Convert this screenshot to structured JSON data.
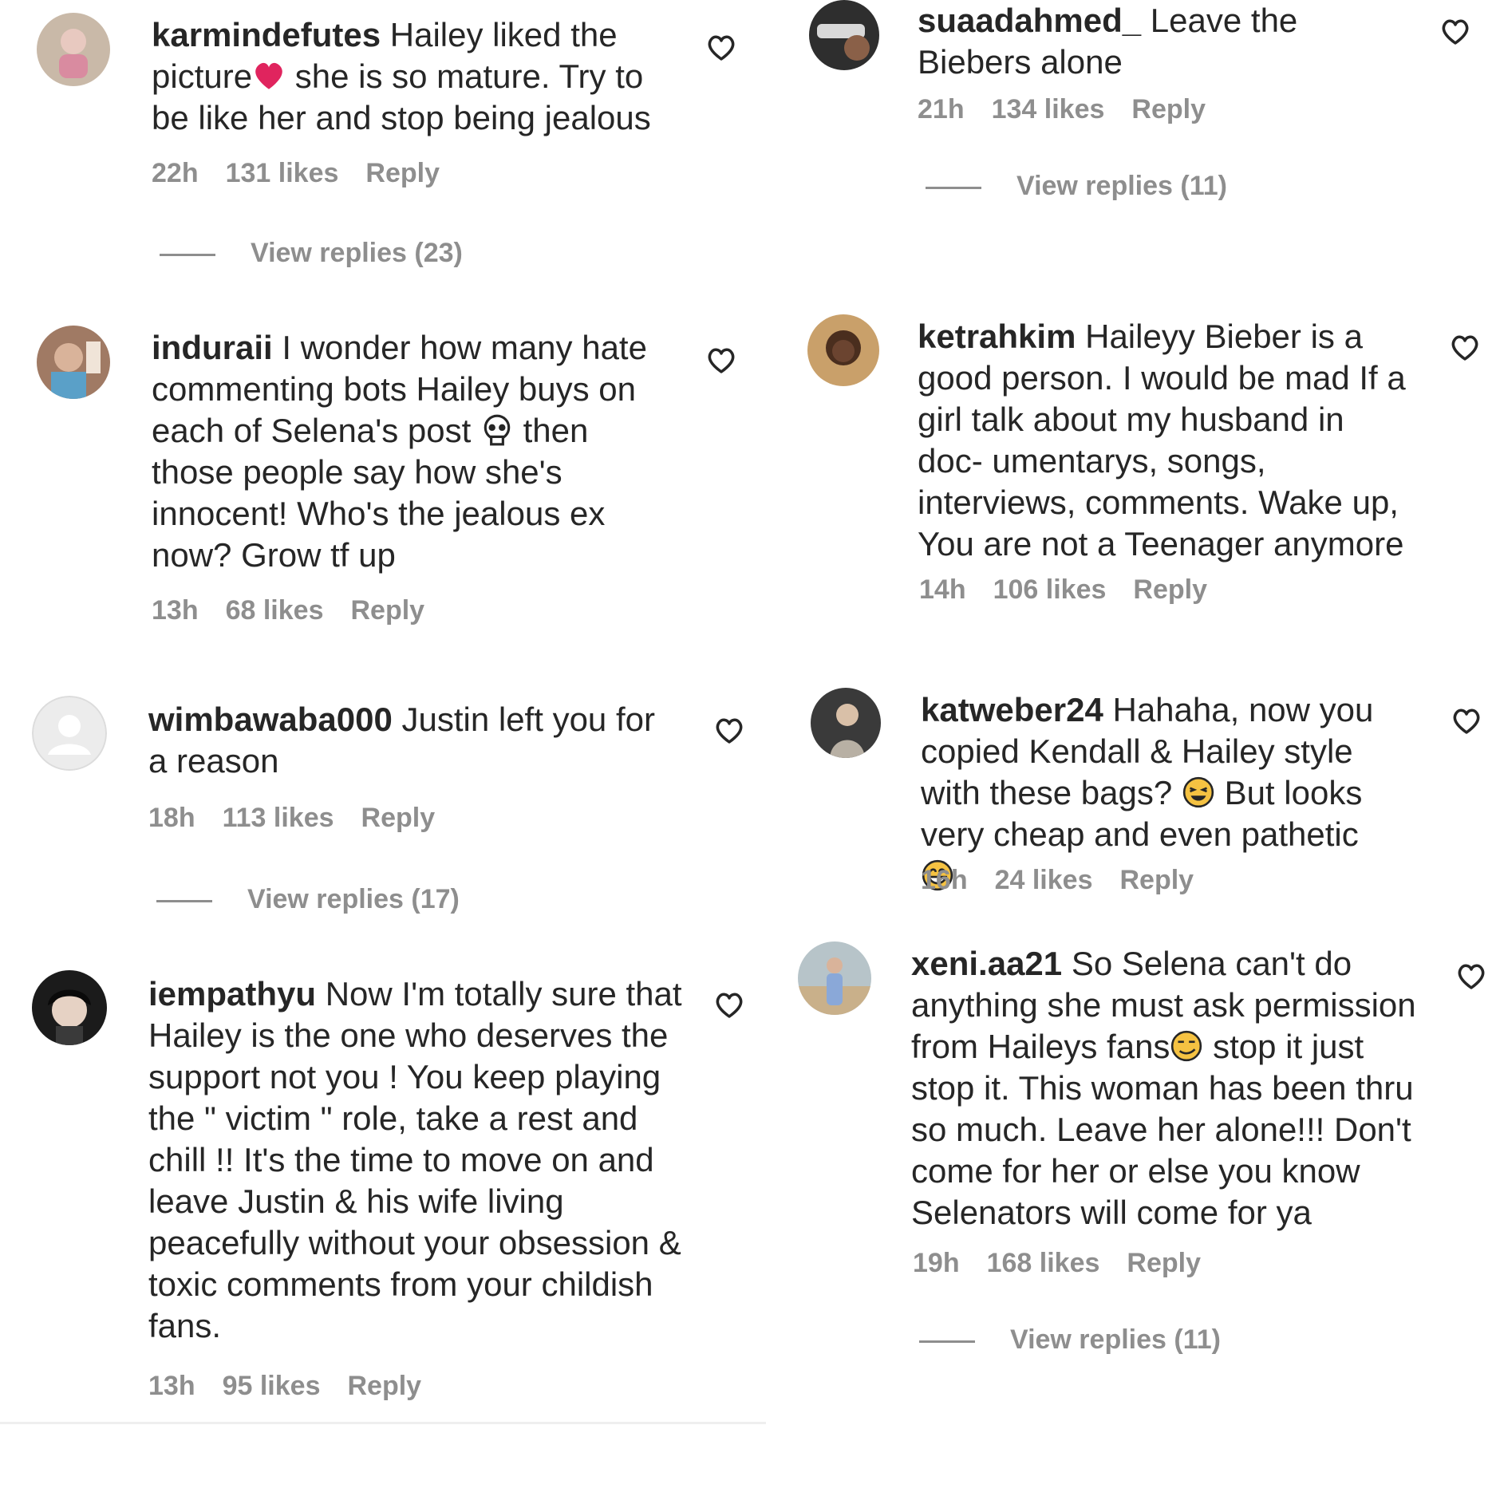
{
  "left": [
    {
      "username": "karmindefutes",
      "text_parts": [
        "Hailey liked the picture",
        "she is so mature. Try to be like her and stop being jealous"
      ],
      "emoji": "red-heart-emoji",
      "time": "22h",
      "likes": "131 likes",
      "reply": "Reply",
      "view_replies": "View replies (23)"
    },
    {
      "username": "induraii",
      "text_parts": [
        "I wonder how many hate commenting bots Hailey buys on each of Selena's post",
        "then those people say how she's innocent! Who's the jealous ex now? Grow tf up"
      ],
      "emoji": "skull-emoji",
      "time": "13h",
      "likes": "68 likes",
      "reply": "Reply"
    },
    {
      "username": "wimbawaba000",
      "text": "Justin left you for a reason",
      "time": "18h",
      "likes": "113 likes",
      "reply": "Reply",
      "view_replies": "View replies (17)"
    },
    {
      "username": "iempathyu",
      "text": "Now I'm totally sure that Hailey is the one who deserves the support not you ! You keep playing the \" victim \" role, take a rest and chill !! It's the time to move on and leave Justin & his wife living peacefully without your obsession & toxic comments from your childish fans.",
      "time": "13h",
      "likes": "95 likes",
      "reply": "Reply"
    }
  ],
  "right": [
    {
      "username": "suaadahmed_",
      "text": "Leave the Biebers alone",
      "time": "21h",
      "likes": "134 likes",
      "reply": "Reply",
      "view_replies": "View replies (11)"
    },
    {
      "username": "ketrahkim",
      "text": "Haileyy Bieber is a good person. I would be mad If a girl talk about my husband in doc- umentarys, songs, interviews, comments. Wake up, You are not a Teenager anymore",
      "time": "14h",
      "likes": "106 likes",
      "reply": "Reply"
    },
    {
      "username": "katweber24",
      "text_parts": [
        "Hahaha, now you copied Kendall & Hailey style with these bags?",
        "But looks very cheap and even pathetic",
        ""
      ],
      "emoji": "laughing-emoji",
      "time": "16h",
      "likes": "24 likes",
      "reply": "Reply"
    },
    {
      "username": "xeni.aa21",
      "text_parts": [
        "So Selena can't do anything she must ask permission from Haileys fans",
        "stop it just stop it. This woman has been thru so much. Leave her alone!!! Don't come for her or else you know Selenators will come for ya"
      ],
      "emoji": "smirk-emoji",
      "time": "19h",
      "likes": "168 likes",
      "reply": "Reply",
      "view_replies": "View replies (11)"
    }
  ],
  "colors": {
    "text": "#262626",
    "meta": "#8e8e8e",
    "heart_emoji": "#e0245e",
    "emoji_face": "#f5c242"
  }
}
